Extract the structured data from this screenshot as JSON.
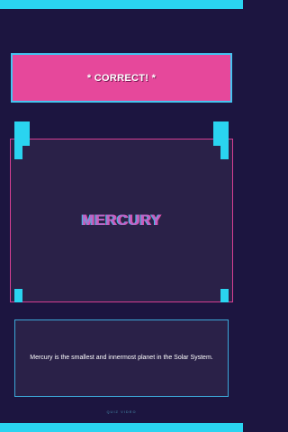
{
  "feedback": {
    "text": "* CORRECT! *"
  },
  "card": {
    "answer": "MERCURY"
  },
  "fact": {
    "text": "Mercury is the smallest and innermost planet in the Solar System."
  },
  "footer": {
    "watermark": "QUIZ VIDEO"
  },
  "colors": {
    "background": "#1c1540",
    "accent_cyan": "#2ad4f0",
    "accent_pink": "#e6489b",
    "panel": "#2a2148"
  }
}
